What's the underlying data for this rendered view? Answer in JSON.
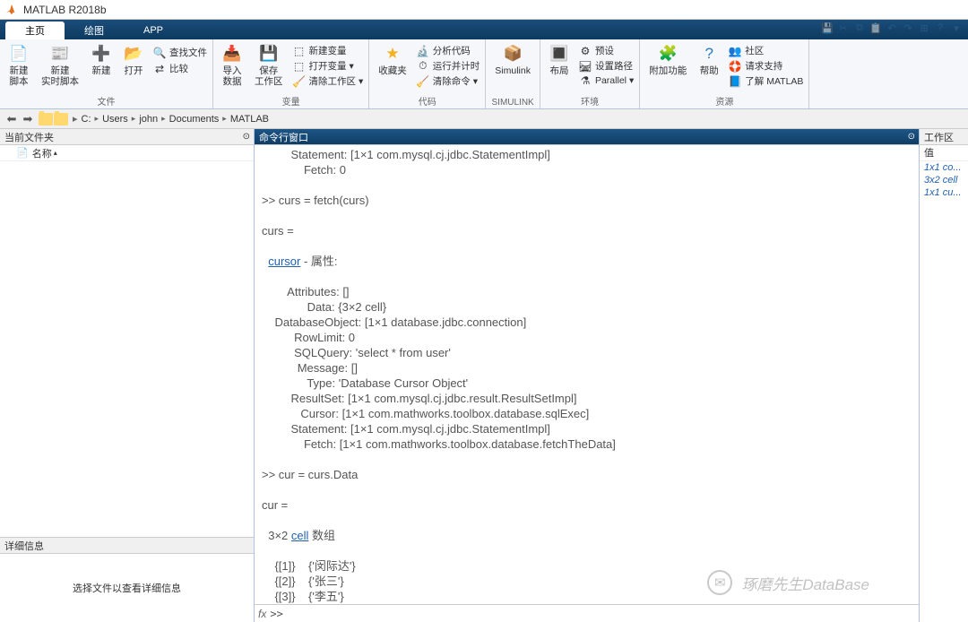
{
  "title": "MATLAB R2018b",
  "tabs": {
    "home": "主页",
    "plots": "绘图",
    "apps": "APP"
  },
  "ribbon": {
    "file_group": "文件",
    "var_group": "变量",
    "code_group": "代码",
    "simulink_group": "SIMULINK",
    "env_group": "环境",
    "res_group": "资源",
    "new_script": "新建\n脚本",
    "new_live": "新建\n实时脚本",
    "new": "新建",
    "open": "打开",
    "find_files": "查找文件",
    "compare": "比较",
    "import": "导入\n数据",
    "save_ws": "保存\n工作区",
    "new_var": "新建变量",
    "open_var": "打开变量",
    "clear_ws": "清除工作区",
    "favorites": "收藏夹",
    "analyze": "分析代码",
    "run_time": "运行并计时",
    "clear_cmd": "清除命令",
    "simulink": "Simulink",
    "layout": "布局",
    "prefs": "预设",
    "setpath": "设置路径",
    "parallel": "Parallel",
    "addons": "附加功能",
    "help": "帮助",
    "community": "社区",
    "support": "请求支持",
    "learn": "了解 MATLAB"
  },
  "breadcrumbs": [
    "C:",
    "Users",
    "john",
    "Documents",
    "MATLAB"
  ],
  "panels": {
    "current_folder": "当前文件夹",
    "name_col": "名称",
    "details": "详细信息",
    "details_msg": "选择文件以查看详细信息",
    "command_window": "命令行窗口",
    "workspace": "工作区",
    "value_col": "值"
  },
  "cmd_lines": [
    "         Statement: [1×1 com.mysql.cj.jdbc.StatementImpl]",
    "             Fetch: 0",
    "",
    ">> curs = fetch(curs)",
    "",
    "curs = ",
    "",
    "  cursor - 属性:",
    "",
    "        Attributes: []",
    "              Data: {3×2 cell}",
    "    DatabaseObject: [1×1 database.jdbc.connection]",
    "          RowLimit: 0",
    "          SQLQuery: 'select * from user'",
    "           Message: []",
    "              Type: 'Database Cursor Object'",
    "         ResultSet: [1×1 com.mysql.cj.jdbc.result.ResultSetImpl]",
    "            Cursor: [1×1 com.mathworks.toolbox.database.sqlExec]",
    "         Statement: [1×1 com.mysql.cj.jdbc.StatementImpl]",
    "             Fetch: [1×1 com.mathworks.toolbox.database.fetchTheData]",
    "",
    ">> cur = curs.Data",
    "",
    "cur =",
    "",
    "  3×2 cell 数组",
    "",
    "    {[1]}    {'闵际达'}",
    "    {[2]}    {'张三'}",
    "    {[3]}    {'李五'}"
  ],
  "cmd_link_word": "cell",
  "cmd_link_word2": "cursor",
  "prompt_fx": "fx",
  "prompt": ">> ",
  "workspace_items": [
    "1x1 co...",
    "3x2 cell",
    "1x1 cu..."
  ],
  "watermark": "琢磨先生DataBase"
}
